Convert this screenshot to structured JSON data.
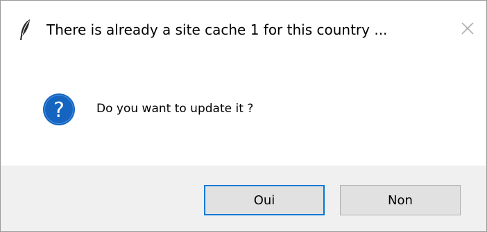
{
  "window": {
    "title": "There is already a site cache 1 for this country  ...",
    "app_icon": "feather-icon",
    "close_icon": "close-icon"
  },
  "message": {
    "icon": "question-icon",
    "text": "Do you want to update it ?"
  },
  "buttons": {
    "yes_label": "Oui",
    "no_label": "Non"
  },
  "colors": {
    "accent": "#0078d7",
    "question_icon_bg": "#1565c0",
    "footer_bg": "#f0f0f0",
    "button_bg": "#e1e1e1"
  }
}
